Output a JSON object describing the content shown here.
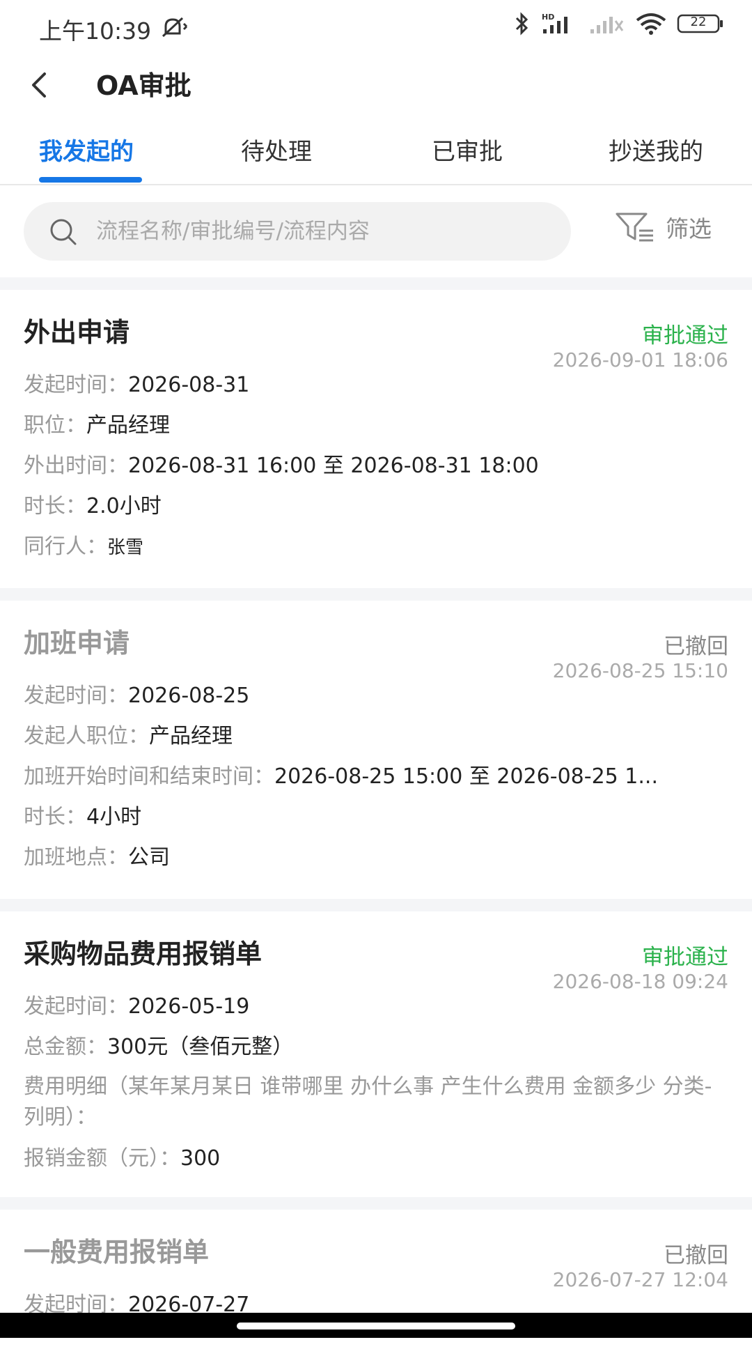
{
  "status_bar": {
    "time": "上午10:39",
    "battery": "22"
  },
  "nav": {
    "title": "OA审批"
  },
  "tabs": [
    {
      "label": "我发起的"
    },
    {
      "label": "待处理"
    },
    {
      "label": "已审批"
    },
    {
      "label": "抄送我的"
    }
  ],
  "search": {
    "placeholder": "流程名称/审批编号/流程内容",
    "filter_label": "筛选"
  },
  "colors": {
    "accent": "#1677e6",
    "approved": "#2bb24c",
    "withdrawn": "#888888"
  },
  "cards": [
    {
      "title": "外出申请",
      "status": "审批通过",
      "time": "2026-09-01 18:06",
      "fields": [
        {
          "label": "发起时间：",
          "value": "2026-08-31"
        },
        {
          "label": "职位：",
          "value": "产品经理"
        },
        {
          "label": "外出时间：",
          "value": "2026-08-31 16:00 至 2026-08-31 18:00"
        },
        {
          "label": "时长：",
          "value": "2.0小时"
        },
        {
          "label": "同行人：",
          "value": "张雪"
        }
      ]
    },
    {
      "title": "加班申请",
      "status": "已撤回",
      "time": "2026-08-25 15:10",
      "fields": [
        {
          "label": "发起时间：",
          "value": "2026-08-25"
        },
        {
          "label": "发起人职位：",
          "value": "产品经理"
        },
        {
          "label": "加班开始时间和结束时间：",
          "value": "2026-08-25 15:00 至 2026-08-25 1..."
        },
        {
          "label": "时长：",
          "value": "4小时"
        },
        {
          "label": "加班地点：",
          "value": "公司"
        }
      ]
    },
    {
      "title": "采购物品费用报销单",
      "status": "审批通过",
      "time": "2026-08-18 09:24",
      "fields": [
        {
          "label": "发起时间：",
          "value": "2026-05-19"
        },
        {
          "label": "总金额：",
          "value": "300元（叁佰元整）"
        },
        {
          "label": "费用明细（某年某月某日 谁带哪里 办什么事 产生什么费用 金额多少 分类-列明）：",
          "value": ""
        },
        {
          "label": "报销金额（元）：",
          "value": "300"
        }
      ]
    },
    {
      "title": "一般费用报销单",
      "status": "已撤回",
      "time": "2026-07-27 12:04",
      "fields": [
        {
          "label": "发起时间：",
          "value": "2026-07-27"
        }
      ]
    }
  ]
}
